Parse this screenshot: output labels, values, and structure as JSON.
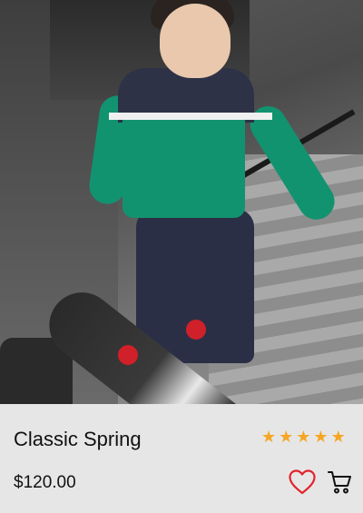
{
  "product": {
    "image_alt": "Boy in green and navy tracksuit riding a skateboard on stairs",
    "title": "Classic Spring",
    "price": "$120.00",
    "rating": 5,
    "rating_max": 5,
    "stars": [
      "★",
      "★",
      "★",
      "★",
      "★"
    ]
  },
  "icons": {
    "favorite": "heart-outline-icon",
    "cart": "shopping-cart-icon",
    "star": "star-icon"
  },
  "colors": {
    "star": "#f5a623",
    "heart": "#e0242c",
    "panel_bg": "#e6e6e6",
    "text": "#111111"
  }
}
